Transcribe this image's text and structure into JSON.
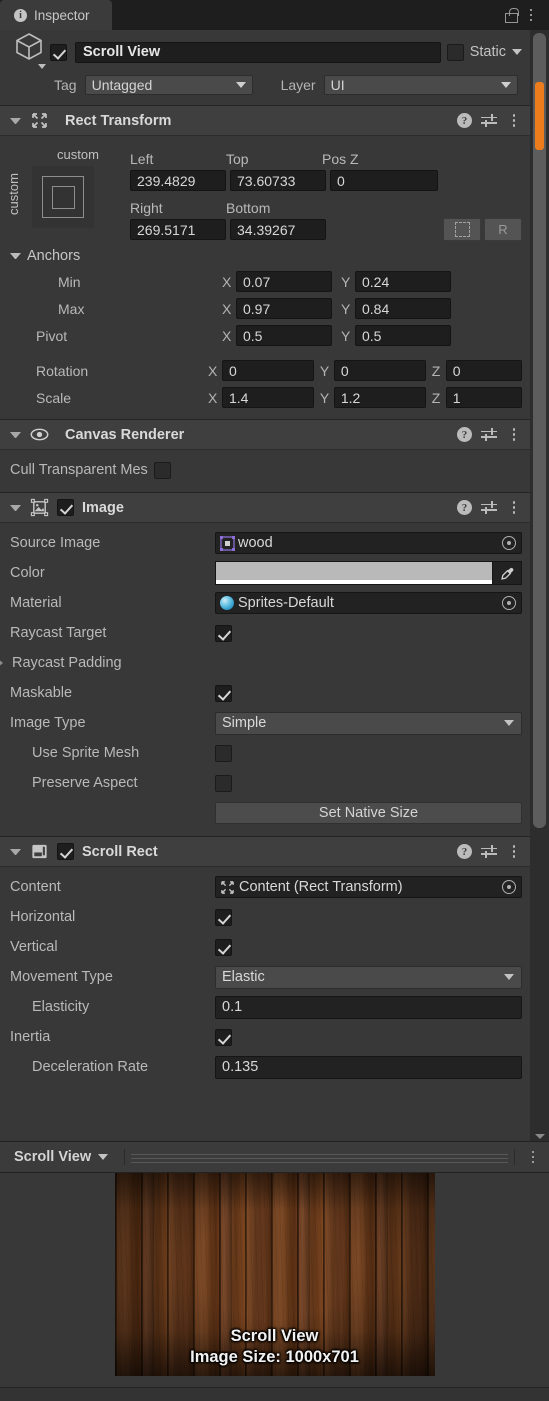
{
  "window": {
    "tab_label": "Inspector",
    "tab_icon": "info-icon",
    "lock_icon": "lock-icon",
    "menu_icon": "kebab-menu-icon"
  },
  "gameobject": {
    "icon": "cube-icon",
    "enabled": true,
    "name": "Scroll View",
    "static_checked": false,
    "static_label": "Static",
    "tag_label": "Tag",
    "tag_value": "Untagged",
    "layer_label": "Layer",
    "layer_value": "UI"
  },
  "rect_transform": {
    "title": "Rect Transform",
    "anchor_preset_top": "custom",
    "anchor_preset_side": "custom",
    "headers": [
      "Left",
      "Top",
      "Pos Z"
    ],
    "headers2": [
      "Right",
      "Bottom"
    ],
    "left": "239.4829",
    "top": "73.60733",
    "pos_z": "0",
    "right": "269.5171",
    "bottom": "34.39267",
    "blueprint_btn": "blueprint-mode-icon",
    "raw_btn": "R",
    "anchors_label": "Anchors",
    "min_label": "Min",
    "min_x": "0.07",
    "min_y": "0.24",
    "max_label": "Max",
    "max_x": "0.97",
    "max_y": "0.84",
    "pivot_label": "Pivot",
    "pivot_x": "0.5",
    "pivot_y": "0.5",
    "rotation_label": "Rotation",
    "rotation_x": "0",
    "rotation_y": "0",
    "rotation_z": "0",
    "scale_label": "Scale",
    "scale_x": "1.4",
    "scale_y": "1.2",
    "scale_z": "1",
    "axis_x": "X",
    "axis_y": "Y",
    "axis_z": "Z"
  },
  "canvas_renderer": {
    "title": "Canvas Renderer",
    "cull_label": "Cull Transparent Mes",
    "cull_checked": false
  },
  "image": {
    "title": "Image",
    "enabled": true,
    "source_image_label": "Source Image",
    "source_image_value": "wood",
    "color_label": "Color",
    "color_value": "#B9B9B9",
    "material_label": "Material",
    "material_value": "Sprites-Default",
    "raycast_target_label": "Raycast Target",
    "raycast_target_checked": true,
    "raycast_padding_label": "Raycast Padding",
    "maskable_label": "Maskable",
    "maskable_checked": true,
    "image_type_label": "Image Type",
    "image_type_value": "Simple",
    "use_sprite_mesh_label": "Use Sprite Mesh",
    "use_sprite_mesh_checked": false,
    "preserve_aspect_label": "Preserve Aspect",
    "preserve_aspect_checked": false,
    "set_native_size_label": "Set Native Size"
  },
  "scroll_rect": {
    "title": "Scroll Rect",
    "enabled": true,
    "content_label": "Content",
    "content_value": "Content (Rect Transform)",
    "horizontal_label": "Horizontal",
    "horizontal_checked": true,
    "vertical_label": "Vertical",
    "vertical_checked": true,
    "movement_type_label": "Movement Type",
    "movement_type_value": "Elastic",
    "elasticity_label": "Elasticity",
    "elasticity_value": "0.1",
    "inertia_label": "Inertia",
    "inertia_checked": true,
    "deceleration_label": "Deceleration Rate",
    "deceleration_value": "0.135"
  },
  "preview": {
    "dropdown_label": "Scroll View",
    "menu_icon": "kebab-menu-icon",
    "caption_line1": "Scroll View",
    "caption_line2": "Image Size: 1000x701"
  },
  "colors": {
    "accent_orange": "#EC7C1C",
    "panel_bg": "#383838",
    "header_bg": "#3F3F3F",
    "field_bg": "#1E1E1E"
  }
}
